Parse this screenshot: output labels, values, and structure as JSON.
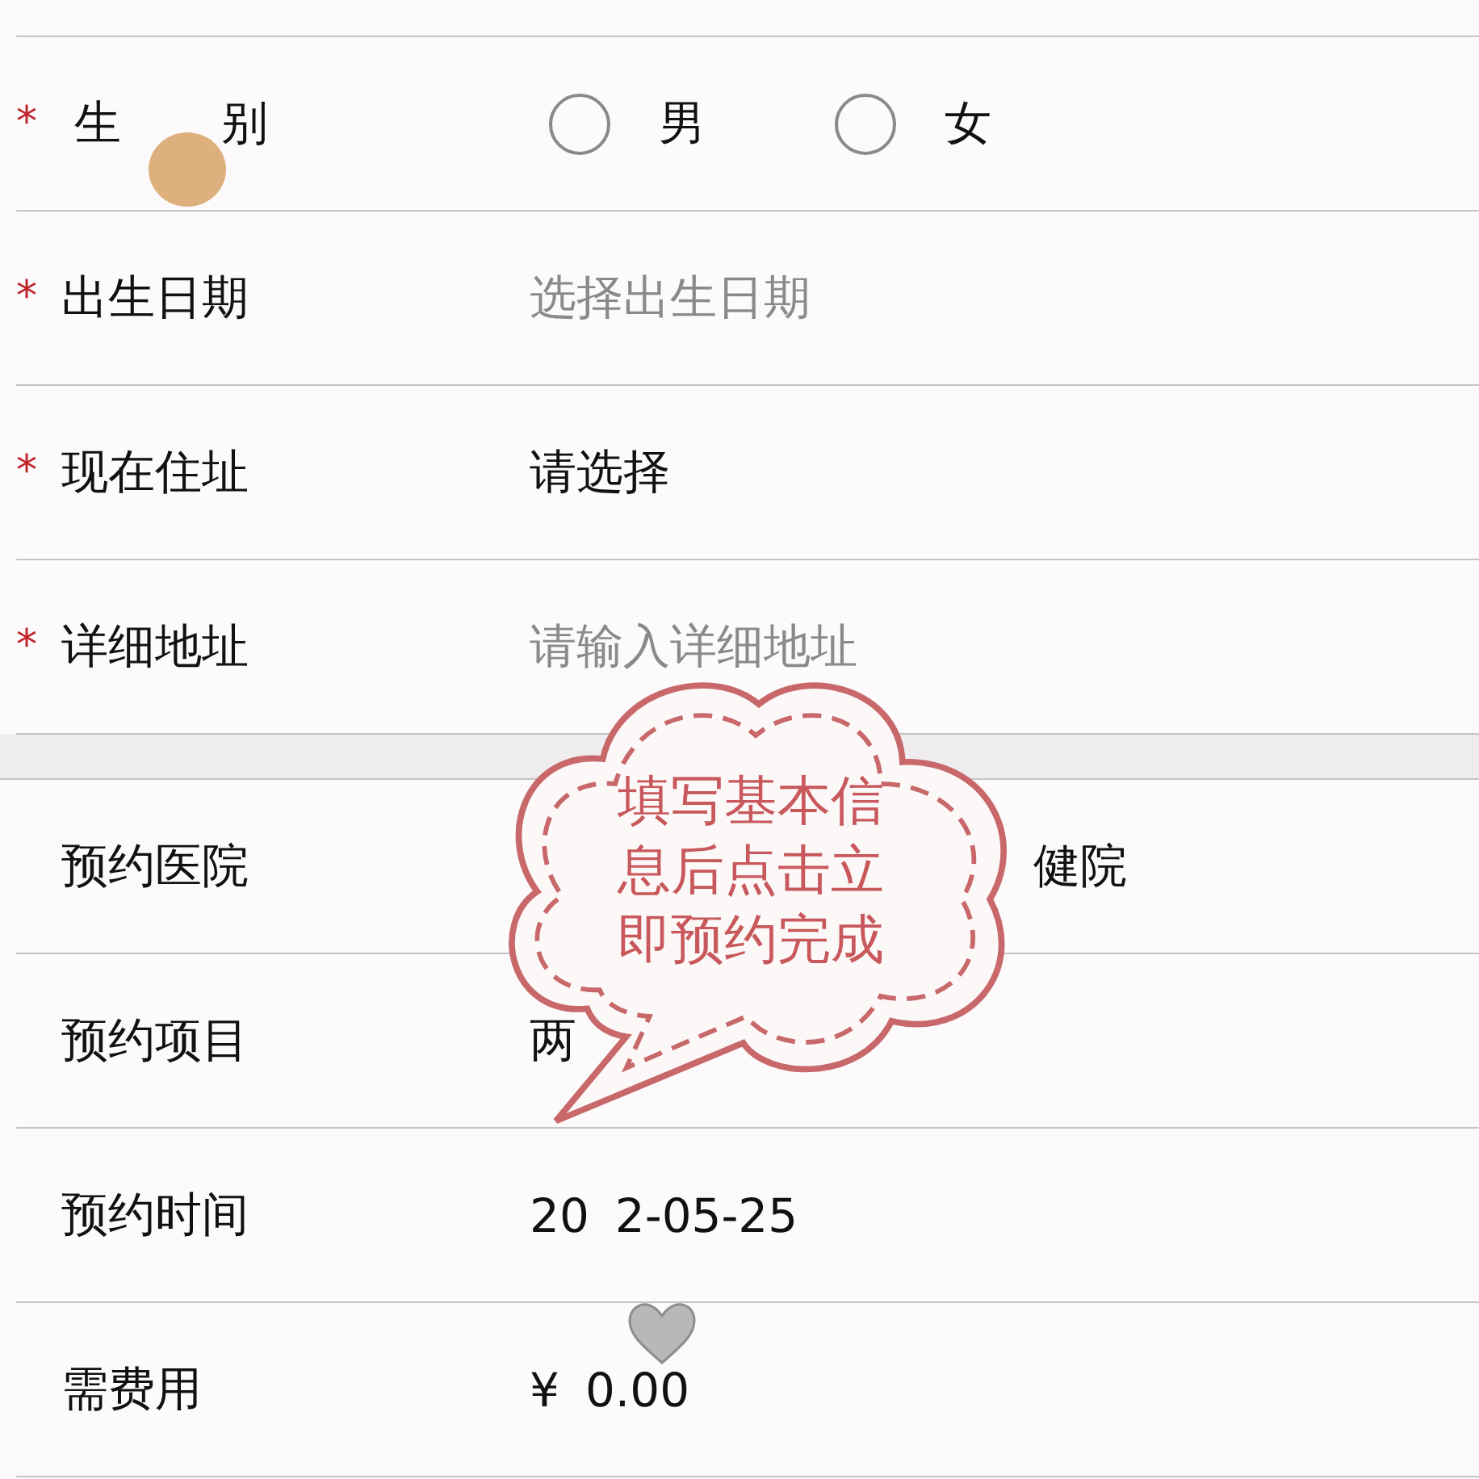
{
  "rows": [
    {
      "kind": "radio",
      "required_mark": "*",
      "label": [
        "生",
        "别"
      ],
      "options": [
        {
          "label": "男",
          "selected": false
        },
        {
          "label": "女",
          "selected": false
        }
      ]
    },
    {
      "kind": "placeholder",
      "required_mark": "*",
      "label": [
        "出生日期"
      ],
      "value": [
        "选择出生日期"
      ]
    },
    {
      "kind": "value",
      "required_mark": "*",
      "label": [
        "现在住址"
      ],
      "value": [
        "请选择"
      ]
    },
    {
      "kind": "placeholder",
      "required_mark": "*",
      "label": [
        "详细地址"
      ],
      "value": [
        "请输入详细地址"
      ]
    },
    {
      "kind": "divider"
    },
    {
      "kind": "obscured",
      "label": [
        "预约医院"
      ],
      "value": [
        "健院"
      ]
    },
    {
      "kind": "value",
      "label": [
        "预约项目"
      ],
      "value": [
        "两"
      ]
    },
    {
      "kind": "value",
      "label": [
        "预约时间"
      ],
      "value": [
        "20",
        "2-05-25"
      ]
    },
    {
      "kind": "value",
      "label": [
        "需费用"
      ],
      "value": [
        "¥",
        "0.00"
      ]
    }
  ],
  "sticker": {
    "lines": [
      "填写基本信",
      "息后点击立",
      "即预约完成"
    ]
  }
}
